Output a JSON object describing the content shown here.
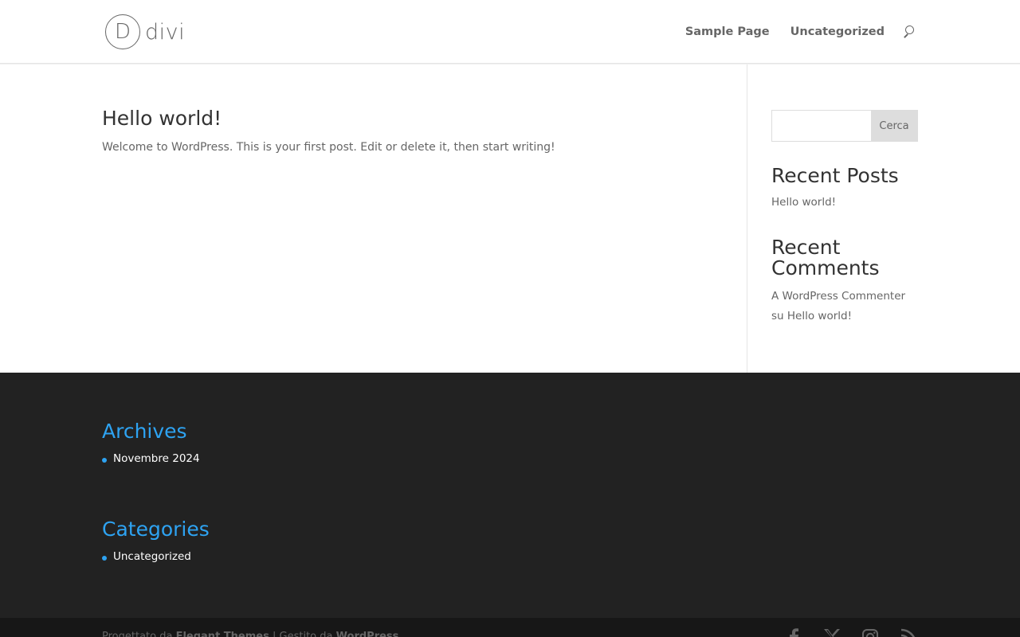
{
  "header": {
    "logo_letter": "D",
    "logo_text": "divi",
    "nav": [
      {
        "label": "Sample Page"
      },
      {
        "label": "Uncategorized"
      }
    ]
  },
  "post": {
    "title": "Hello world!",
    "excerpt": "Welcome to WordPress. This is your first post. Edit or delete it, then start writing!"
  },
  "sidebar": {
    "search": {
      "value": "",
      "placeholder": "",
      "button_label": "Cerca"
    },
    "recent_posts": {
      "title": "Recent Posts",
      "items": [
        "Hello world!"
      ]
    },
    "recent_comments": {
      "title": "Recent Comments",
      "items": [
        {
          "author": "A WordPress Commenter",
          "connector": "su",
          "post": "Hello world!"
        }
      ]
    }
  },
  "footer": {
    "archives": {
      "title": "Archives",
      "items": [
        "Novembre 2024"
      ]
    },
    "categories": {
      "title": "Categories",
      "items": [
        "Uncategorized"
      ]
    },
    "credits": {
      "prefix": "Progettato da",
      "theme": "Elegant Themes",
      "separator": "|",
      "powered": "Gestito da",
      "cms": "WordPress"
    },
    "social": [
      "facebook-icon",
      "x-icon",
      "instagram-icon",
      "rss-icon"
    ]
  },
  "colors": {
    "accent": "#2ea3f2",
    "footer_bg": "#222222",
    "bottom_bar_bg": "#171717",
    "text": "#666666",
    "heading": "#333333"
  }
}
